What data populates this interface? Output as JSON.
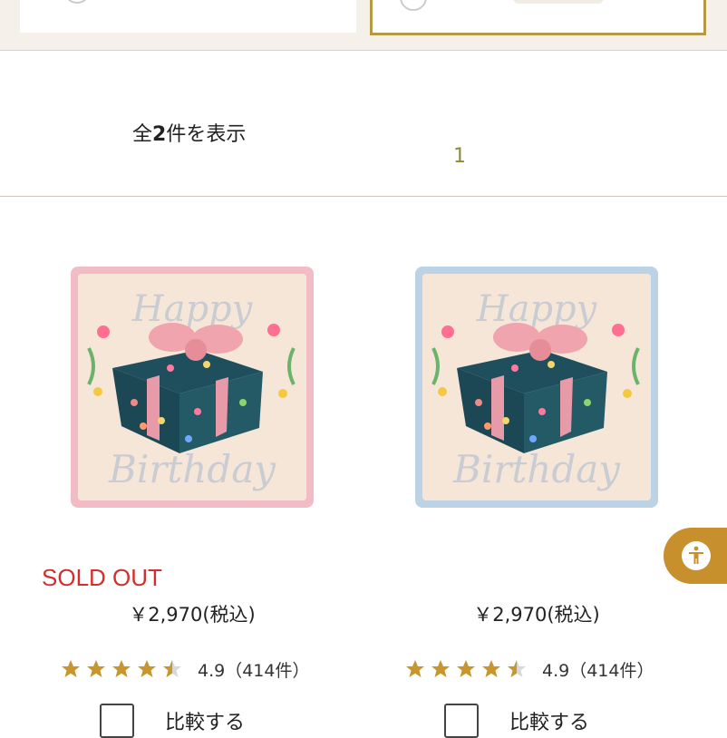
{
  "result_bar": {
    "count_prefix": "全",
    "count_number": "2",
    "count_suffix": "件を表示",
    "current_page": "1"
  },
  "products": [
    {
      "sold_out_label": "SOLD OUT",
      "price": "￥2,970(税込)",
      "rating_value": 4.5,
      "rating_text": "4.9（414件）",
      "compare_label": "比較する",
      "image": {
        "banner_top": "Happy",
        "banner_bottom": "Birthday",
        "border_color": "#f2bcc6"
      }
    },
    {
      "sold_out_label": "",
      "price": "￥2,970(税込)",
      "rating_value": 4.5,
      "rating_text": "4.9（414件）",
      "compare_label": "比較する",
      "image": {
        "banner_top": "Happy",
        "banner_bottom": "Birthday",
        "border_color": "#bcd3e6"
      }
    }
  ],
  "colors": {
    "accent_gold": "#b59a45",
    "star": "#c8962e",
    "sold_out": "#d32f2f",
    "a11y_button": "#c8902d"
  },
  "icons": {
    "star": "star-icon",
    "accessibility": "accessibility-icon"
  }
}
